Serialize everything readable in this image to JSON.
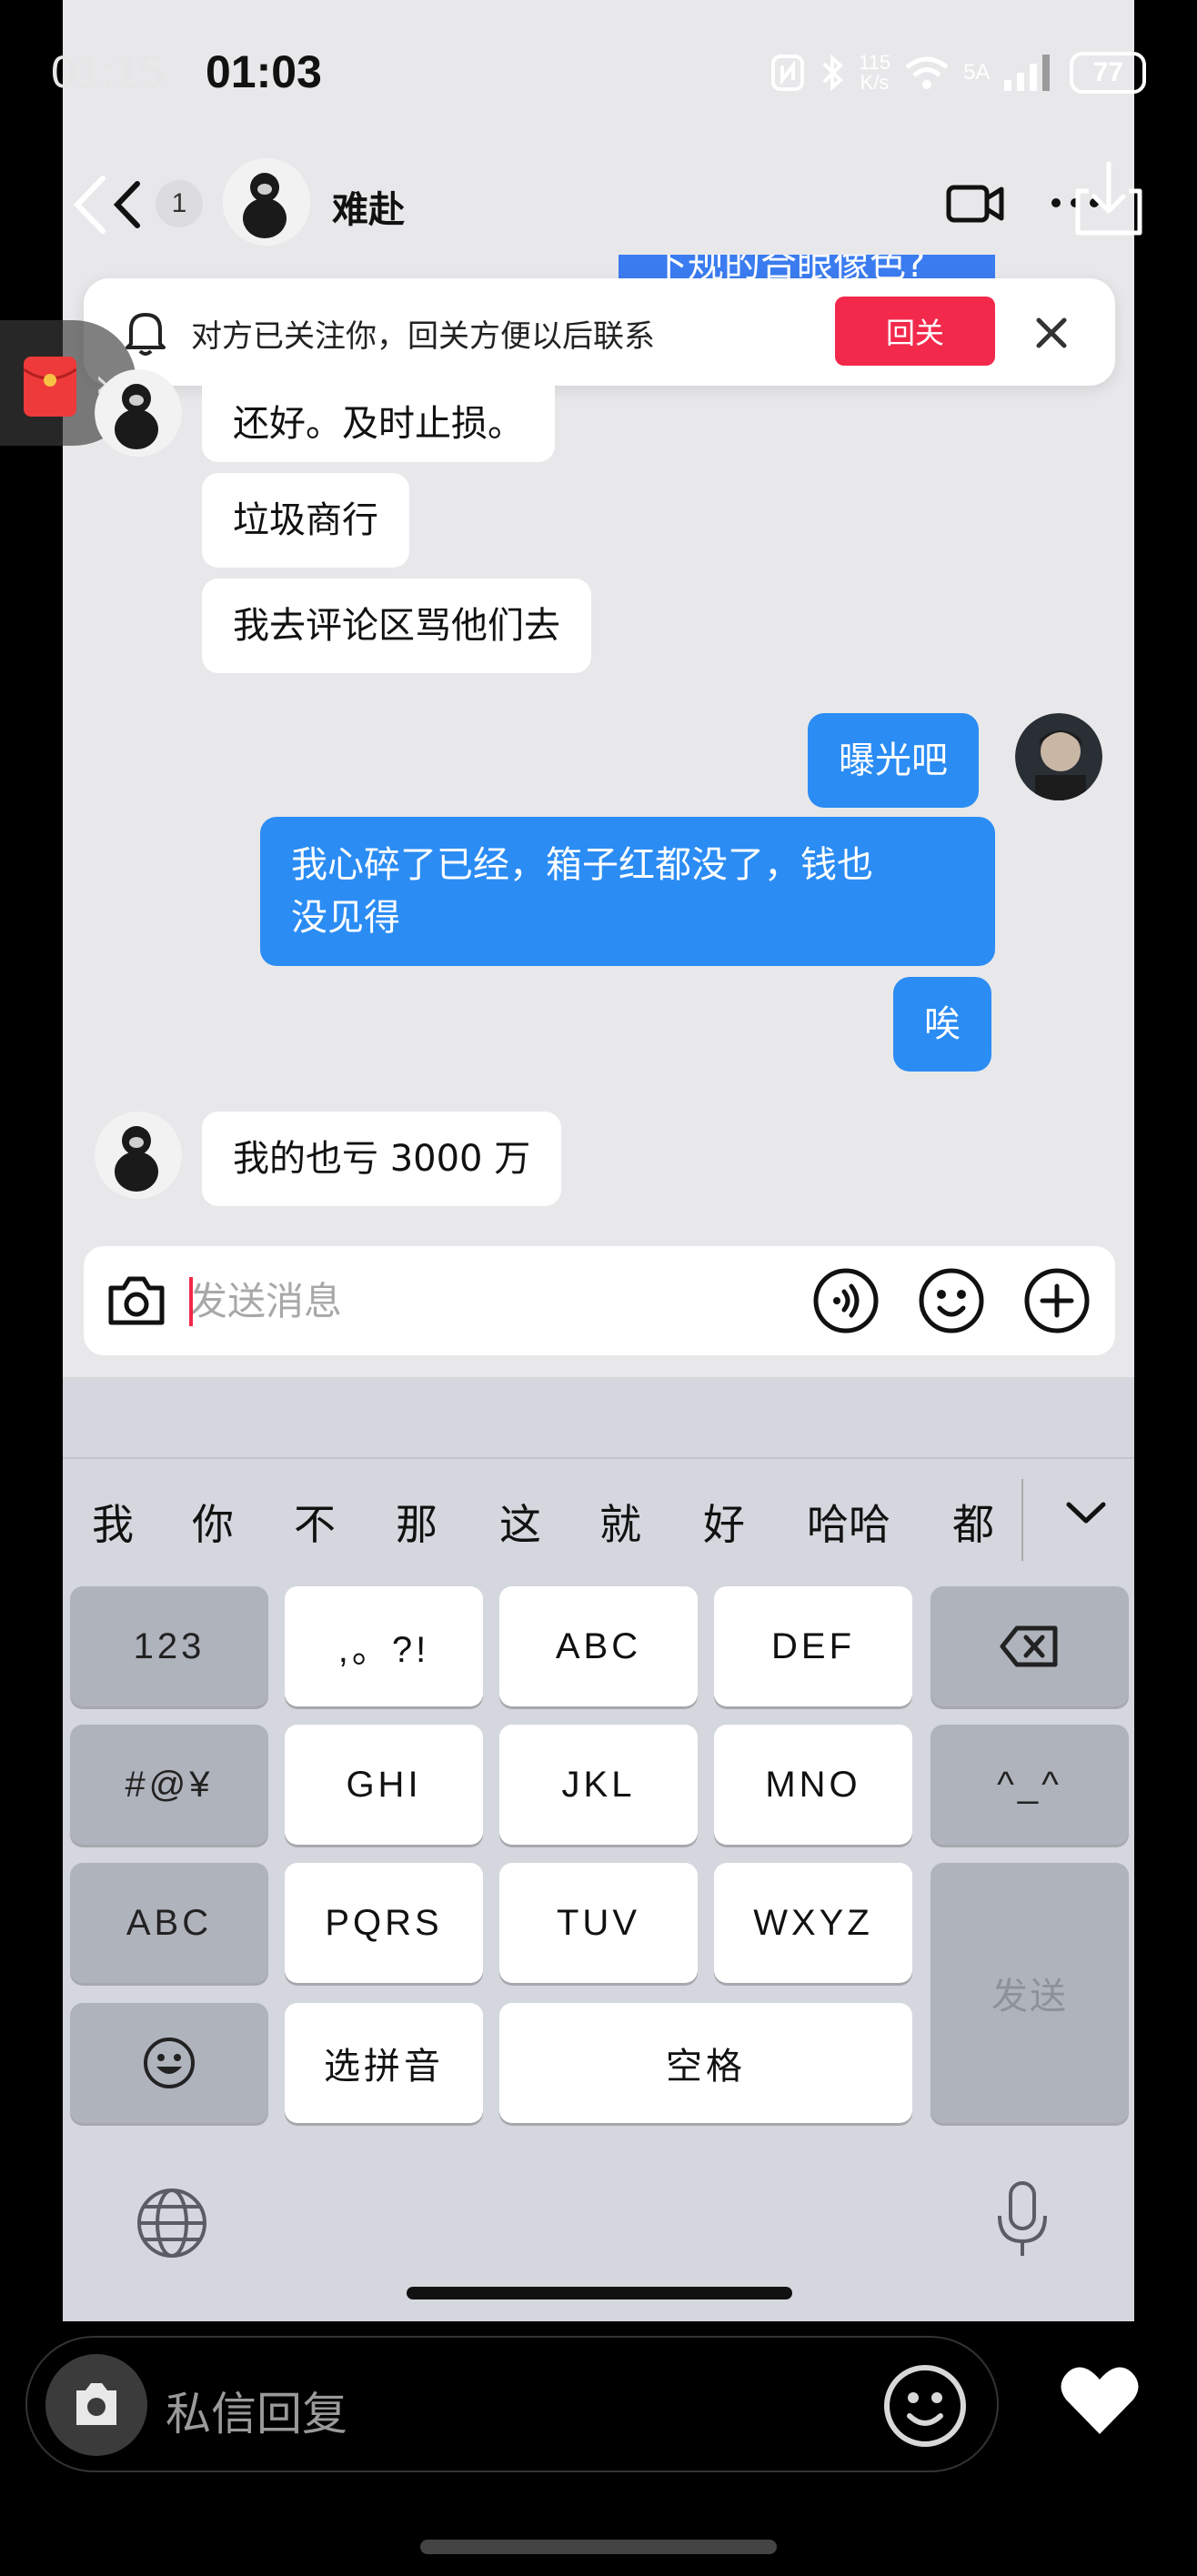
{
  "status_bar": {
    "time_outer": "01:15",
    "time_inner": "01:03",
    "net_speed_line1": "115",
    "net_speed_line2": "K/s",
    "network": "5A",
    "battery": "77"
  },
  "header": {
    "back_label": "<",
    "unread_count": "1",
    "contact_name": "难赴",
    "partial_message": "下规的合眼像色?"
  },
  "follow_banner": {
    "text": "对方已关注你，回关方便以后联系",
    "button": "回关"
  },
  "messages": [
    {
      "side": "in",
      "text": "还好。及时止损。"
    },
    {
      "side": "in",
      "text": "垃圾商行"
    },
    {
      "side": "in",
      "text": "我去评论区骂他们去"
    },
    {
      "side": "out",
      "text": "曝光吧"
    },
    {
      "side": "out",
      "text_line1": "我心碎了已经，箱子红都没了，钱也",
      "text_line2": "没见得"
    },
    {
      "side": "out",
      "text": "唉"
    },
    {
      "side": "in",
      "text": "我的也亏 3000 万"
    }
  ],
  "input": {
    "placeholder": "发送消息",
    "value": ""
  },
  "keyboard": {
    "candidates": [
      "我",
      "你",
      "不",
      "那",
      "这",
      "就",
      "好",
      "哈哈",
      "都"
    ],
    "keys": {
      "num": "123",
      "punct": ",。?!",
      "abc": "ABC",
      "def": "DEF",
      "sym": "#@¥",
      "ghi": "GHI",
      "jkl": "JKL",
      "mno": "MNO",
      "face": "^_^",
      "abc_switch": "ABC",
      "pqrs": "PQRS",
      "tuv": "TUV",
      "wxyz": "WXYZ",
      "send": "发送",
      "pinyin": "选拼音",
      "space": "空格"
    }
  },
  "outer_bar": {
    "placeholder": "私信回复"
  },
  "colors": {
    "outgoing_bubble": "#2b8cf4",
    "follow_button": "#f2294b",
    "keyboard_bg": "#d4d7dd"
  }
}
